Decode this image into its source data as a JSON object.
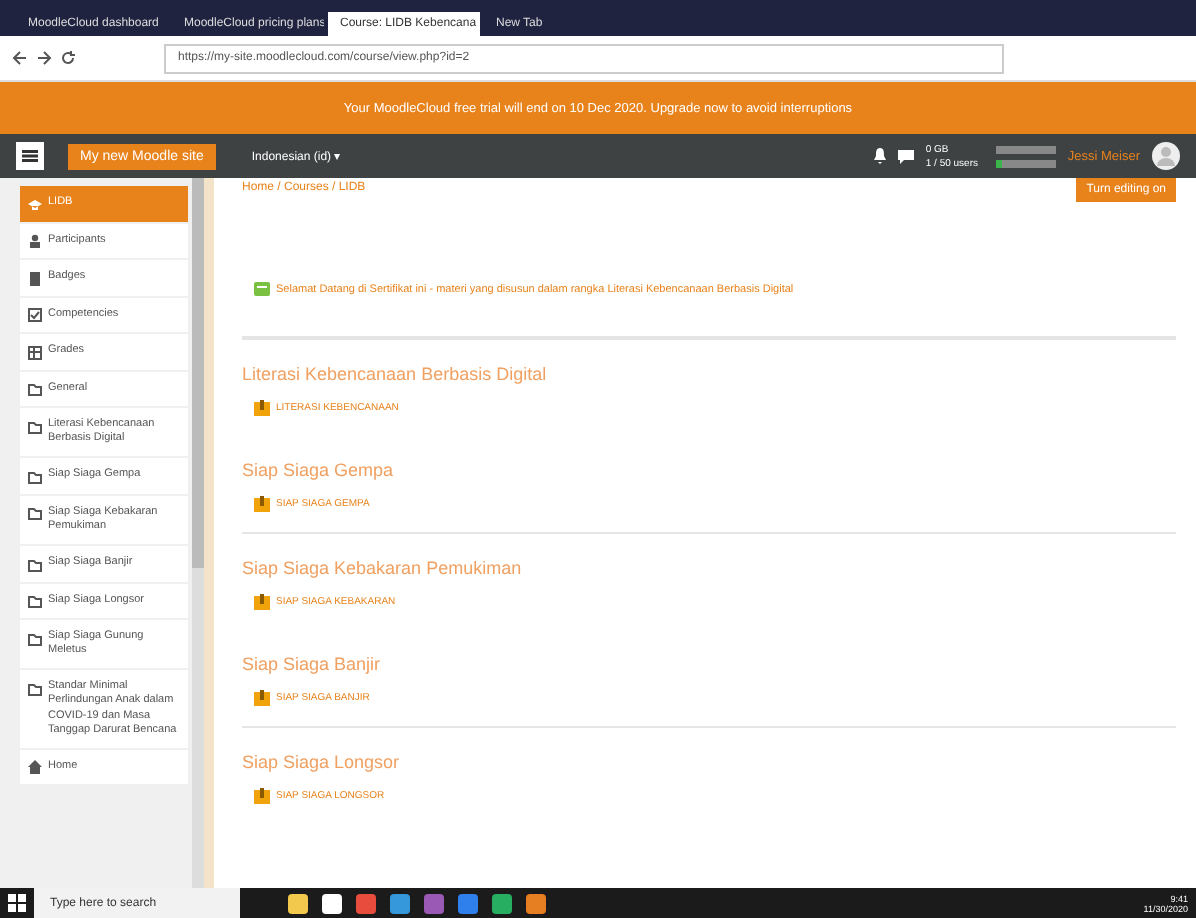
{
  "browser": {
    "tabs": [
      {
        "label": "MoodleCloud dashboard",
        "selected": false
      },
      {
        "label": "MoodleCloud pricing plans",
        "selected": false
      },
      {
        "label": "Course: LIDB Kebencana",
        "selected": true
      },
      {
        "label": "New Tab",
        "selected": false
      }
    ],
    "url": "https://my-site.moodlecloud.com/course/view.php?id=2"
  },
  "banner": "Your MoodleCloud free trial will end on 10 Dec 2020. Upgrade now to avoid interruptions",
  "navbar": {
    "site_button": "My new Moodle site",
    "language": "Indonesian (id) ▾",
    "usage": [
      {
        "label": "0 GB"
      },
      {
        "label": "1 / 50 users",
        "level": 0.1
      }
    ],
    "user": "Jessi Meiser"
  },
  "sidebar": [
    {
      "label": "LIDB",
      "selected": true
    },
    {
      "label": "Participants",
      "selected": false
    },
    {
      "label": "Badges",
      "selected": false
    },
    {
      "label": "Competencies",
      "selected": false
    },
    {
      "label": "Grades",
      "selected": false
    },
    {
      "label": "General",
      "selected": false
    },
    {
      "label": "Literasi Kebencanaan Berbasis Digital",
      "selected": false
    },
    {
      "label": "Siap Siaga Gempa",
      "selected": false
    },
    {
      "label": "Siap Siaga Kebakaran Pemukiman",
      "selected": false
    },
    {
      "label": "Siap Siaga Banjir",
      "selected": false
    },
    {
      "label": "Siap Siaga Longsor",
      "selected": false
    },
    {
      "label": "Siap Siaga Gunung Meletus",
      "selected": false
    },
    {
      "label": "Standar Minimal Perlindungan Anak dalam COVID-19 dan Masa Tanggap Darurat Bencana",
      "selected": false
    },
    {
      "label": "Home",
      "selected": false
    }
  ],
  "breadcrumb": "Home / Courses / LIDB",
  "edit_button": "Turn editing on",
  "intro": "Selamat Datang di Sertifikat ini - materi yang disusun dalam rangka Literasi Kebencanaan Berbasis Digital",
  "sections": [
    {
      "title": "Literasi Kebencanaan Berbasis Digital",
      "resource": "LITERASI KEBENCANAAN"
    },
    {
      "title": "Siap Siaga Gempa",
      "resource": "SIAP SIAGA GEMPA"
    },
    {
      "title": "Siap Siaga Kebakaran Pemukiman",
      "resource": "SIAP SIAGA KEBAKARAN"
    },
    {
      "title": "Siap Siaga Banjir",
      "resource": "SIAP SIAGA BANJIR"
    },
    {
      "title": "Siap Siaga Longsor",
      "resource": "SIAP SIAGA LONGSOR"
    }
  ],
  "taskbar": {
    "search": "Type here to search",
    "time": "9:41",
    "date": "11/30/2020"
  }
}
